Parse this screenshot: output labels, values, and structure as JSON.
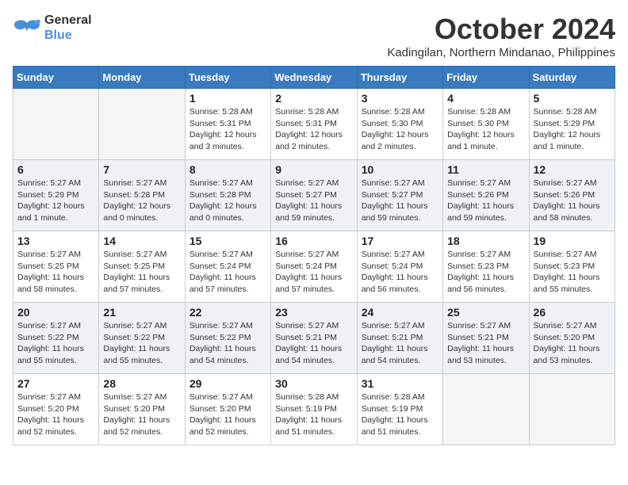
{
  "logo": {
    "line1": "General",
    "line2": "Blue"
  },
  "title": "October 2024",
  "subtitle": "Kadingilan, Northern Mindanao, Philippines",
  "days_header": [
    "Sunday",
    "Monday",
    "Tuesday",
    "Wednesday",
    "Thursday",
    "Friday",
    "Saturday"
  ],
  "weeks": [
    [
      {
        "day": "",
        "info": ""
      },
      {
        "day": "",
        "info": ""
      },
      {
        "day": "1",
        "info": "Sunrise: 5:28 AM\nSunset: 5:31 PM\nDaylight: 12 hours\nand 3 minutes."
      },
      {
        "day": "2",
        "info": "Sunrise: 5:28 AM\nSunset: 5:31 PM\nDaylight: 12 hours\nand 2 minutes."
      },
      {
        "day": "3",
        "info": "Sunrise: 5:28 AM\nSunset: 5:30 PM\nDaylight: 12 hours\nand 2 minutes."
      },
      {
        "day": "4",
        "info": "Sunrise: 5:28 AM\nSunset: 5:30 PM\nDaylight: 12 hours\nand 1 minute."
      },
      {
        "day": "5",
        "info": "Sunrise: 5:28 AM\nSunset: 5:29 PM\nDaylight: 12 hours\nand 1 minute."
      }
    ],
    [
      {
        "day": "6",
        "info": "Sunrise: 5:27 AM\nSunset: 5:29 PM\nDaylight: 12 hours\nand 1 minute."
      },
      {
        "day": "7",
        "info": "Sunrise: 5:27 AM\nSunset: 5:28 PM\nDaylight: 12 hours\nand 0 minutes."
      },
      {
        "day": "8",
        "info": "Sunrise: 5:27 AM\nSunset: 5:28 PM\nDaylight: 12 hours\nand 0 minutes."
      },
      {
        "day": "9",
        "info": "Sunrise: 5:27 AM\nSunset: 5:27 PM\nDaylight: 11 hours\nand 59 minutes."
      },
      {
        "day": "10",
        "info": "Sunrise: 5:27 AM\nSunset: 5:27 PM\nDaylight: 11 hours\nand 59 minutes."
      },
      {
        "day": "11",
        "info": "Sunrise: 5:27 AM\nSunset: 5:26 PM\nDaylight: 11 hours\nand 59 minutes."
      },
      {
        "day": "12",
        "info": "Sunrise: 5:27 AM\nSunset: 5:26 PM\nDaylight: 11 hours\nand 58 minutes."
      }
    ],
    [
      {
        "day": "13",
        "info": "Sunrise: 5:27 AM\nSunset: 5:25 PM\nDaylight: 11 hours\nand 58 minutes."
      },
      {
        "day": "14",
        "info": "Sunrise: 5:27 AM\nSunset: 5:25 PM\nDaylight: 11 hours\nand 57 minutes."
      },
      {
        "day": "15",
        "info": "Sunrise: 5:27 AM\nSunset: 5:24 PM\nDaylight: 11 hours\nand 57 minutes."
      },
      {
        "day": "16",
        "info": "Sunrise: 5:27 AM\nSunset: 5:24 PM\nDaylight: 11 hours\nand 57 minutes."
      },
      {
        "day": "17",
        "info": "Sunrise: 5:27 AM\nSunset: 5:24 PM\nDaylight: 11 hours\nand 56 minutes."
      },
      {
        "day": "18",
        "info": "Sunrise: 5:27 AM\nSunset: 5:23 PM\nDaylight: 11 hours\nand 56 minutes."
      },
      {
        "day": "19",
        "info": "Sunrise: 5:27 AM\nSunset: 5:23 PM\nDaylight: 11 hours\nand 55 minutes."
      }
    ],
    [
      {
        "day": "20",
        "info": "Sunrise: 5:27 AM\nSunset: 5:22 PM\nDaylight: 11 hours\nand 55 minutes."
      },
      {
        "day": "21",
        "info": "Sunrise: 5:27 AM\nSunset: 5:22 PM\nDaylight: 11 hours\nand 55 minutes."
      },
      {
        "day": "22",
        "info": "Sunrise: 5:27 AM\nSunset: 5:22 PM\nDaylight: 11 hours\nand 54 minutes."
      },
      {
        "day": "23",
        "info": "Sunrise: 5:27 AM\nSunset: 5:21 PM\nDaylight: 11 hours\nand 54 minutes."
      },
      {
        "day": "24",
        "info": "Sunrise: 5:27 AM\nSunset: 5:21 PM\nDaylight: 11 hours\nand 54 minutes."
      },
      {
        "day": "25",
        "info": "Sunrise: 5:27 AM\nSunset: 5:21 PM\nDaylight: 11 hours\nand 53 minutes."
      },
      {
        "day": "26",
        "info": "Sunrise: 5:27 AM\nSunset: 5:20 PM\nDaylight: 11 hours\nand 53 minutes."
      }
    ],
    [
      {
        "day": "27",
        "info": "Sunrise: 5:27 AM\nSunset: 5:20 PM\nDaylight: 11 hours\nand 52 minutes."
      },
      {
        "day": "28",
        "info": "Sunrise: 5:27 AM\nSunset: 5:20 PM\nDaylight: 11 hours\nand 52 minutes."
      },
      {
        "day": "29",
        "info": "Sunrise: 5:27 AM\nSunset: 5:20 PM\nDaylight: 11 hours\nand 52 minutes."
      },
      {
        "day": "30",
        "info": "Sunrise: 5:28 AM\nSunset: 5:19 PM\nDaylight: 11 hours\nand 51 minutes."
      },
      {
        "day": "31",
        "info": "Sunrise: 5:28 AM\nSunset: 5:19 PM\nDaylight: 11 hours\nand 51 minutes."
      },
      {
        "day": "",
        "info": ""
      },
      {
        "day": "",
        "info": ""
      }
    ]
  ]
}
